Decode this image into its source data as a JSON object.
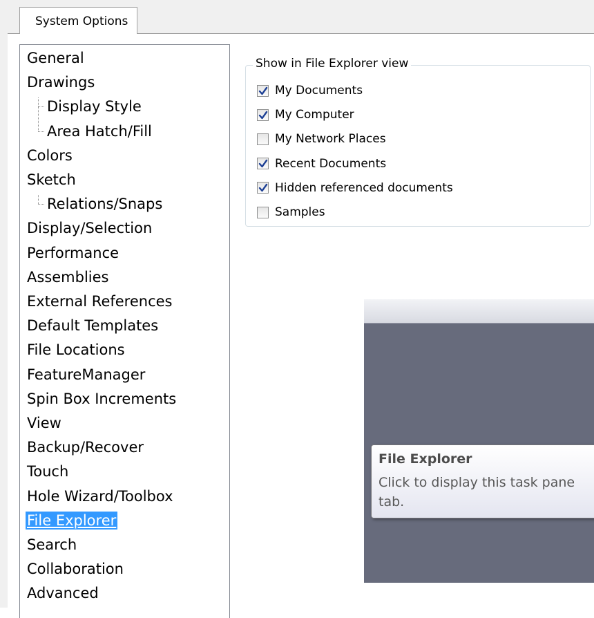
{
  "tab": {
    "label": "System Options"
  },
  "tree": {
    "items": [
      {
        "label": "General",
        "level": 0
      },
      {
        "label": "Drawings",
        "level": 0
      },
      {
        "label": "Display Style",
        "level": 1
      },
      {
        "label": "Area Hatch/Fill",
        "level": 1
      },
      {
        "label": "Colors",
        "level": 0
      },
      {
        "label": "Sketch",
        "level": 0
      },
      {
        "label": "Relations/Snaps",
        "level": 1
      },
      {
        "label": "Display/Selection",
        "level": 0
      },
      {
        "label": "Performance",
        "level": 0
      },
      {
        "label": "Assemblies",
        "level": 0
      },
      {
        "label": "External References",
        "level": 0
      },
      {
        "label": "Default Templates",
        "level": 0
      },
      {
        "label": "File Locations",
        "level": 0
      },
      {
        "label": "FeatureManager",
        "level": 0
      },
      {
        "label": "Spin Box Increments",
        "level": 0
      },
      {
        "label": "View",
        "level": 0
      },
      {
        "label": "Backup/Recover",
        "level": 0
      },
      {
        "label": "Touch",
        "level": 0
      },
      {
        "label": "Hole Wizard/Toolbox",
        "level": 0
      },
      {
        "label": "File Explorer",
        "level": 0,
        "selected": true
      },
      {
        "label": "Search",
        "level": 0
      },
      {
        "label": "Collaboration",
        "level": 0
      },
      {
        "label": "Advanced",
        "level": 0
      }
    ]
  },
  "explorer_group": {
    "title": "Show in File Explorer view",
    "options": [
      {
        "label": "My Documents",
        "checked": true
      },
      {
        "label": "My Computer",
        "checked": true
      },
      {
        "label": "My Network Places",
        "checked": false
      },
      {
        "label": "Recent Documents",
        "checked": true
      },
      {
        "label": "Hidden referenced documents",
        "checked": true
      },
      {
        "label": "Samples",
        "checked": false
      }
    ]
  },
  "tooltip": {
    "title": "File Explorer",
    "line1": "Click to display this task pane",
    "line2": "tab."
  },
  "colors": {
    "selection": "#3399ff",
    "checkmark": "#1c3f94",
    "panel": "#676b7c"
  }
}
